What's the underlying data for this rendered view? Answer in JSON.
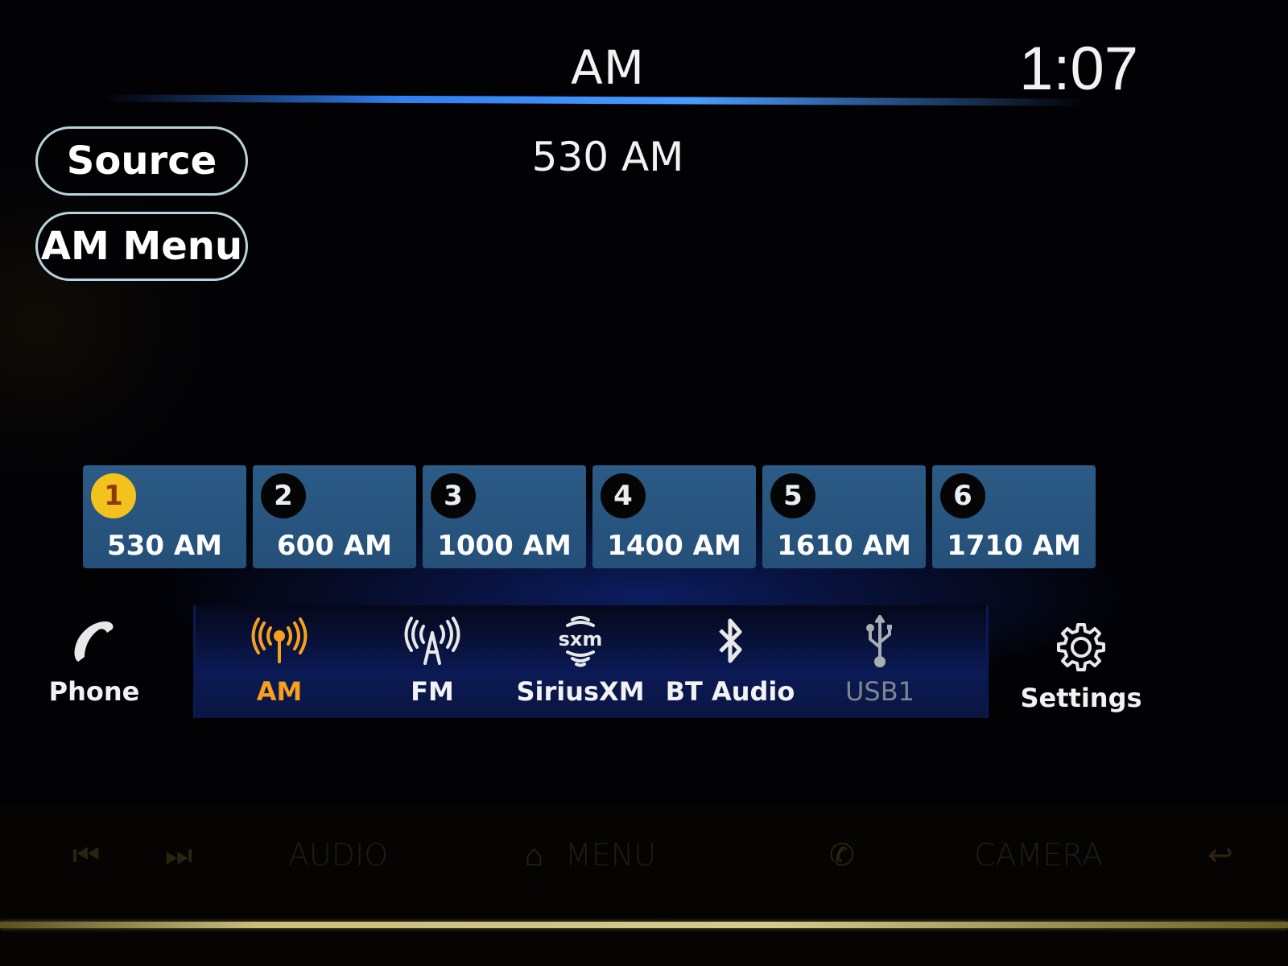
{
  "header": {
    "title": "AM",
    "clock": "1:07"
  },
  "now_playing": {
    "station": "530 AM"
  },
  "buttons": {
    "source": "Source",
    "am_menu": "AM Menu"
  },
  "presets": [
    {
      "number": "1",
      "frequency": "530 AM",
      "active": true
    },
    {
      "number": "2",
      "frequency": "600 AM",
      "active": false
    },
    {
      "number": "3",
      "frequency": "1000 AM",
      "active": false
    },
    {
      "number": "4",
      "frequency": "1400 AM",
      "active": false
    },
    {
      "number": "5",
      "frequency": "1610 AM",
      "active": false
    },
    {
      "number": "6",
      "frequency": "1710 AM",
      "active": false
    }
  ],
  "nav": {
    "phone": {
      "label": "Phone",
      "icon": "phone-icon"
    },
    "am": {
      "label": "AM",
      "icon": "antenna-icon",
      "active": true
    },
    "fm": {
      "label": "FM",
      "icon": "radio-tower-icon"
    },
    "siriusxm": {
      "label": "SiriusXM",
      "icon": "sxm-icon"
    },
    "bt_audio": {
      "label": "BT Audio",
      "icon": "bluetooth-icon"
    },
    "usb1": {
      "label": "USB1",
      "icon": "usb-icon",
      "disabled": true
    },
    "settings": {
      "label": "Settings",
      "icon": "gear-icon"
    }
  },
  "hardware_buttons": {
    "seek_back": "prev-track-icon",
    "seek_forward": "next-track-icon",
    "audio": "AUDIO",
    "menu": "MENU",
    "phone": "phone-icon",
    "camera": "CAMERA",
    "back": "back-icon"
  },
  "colors": {
    "accent_active": "#f7a020",
    "preset_active": "#f4c21c",
    "preset_bg": "#2b5b86",
    "header_line": "#3a8cff"
  }
}
